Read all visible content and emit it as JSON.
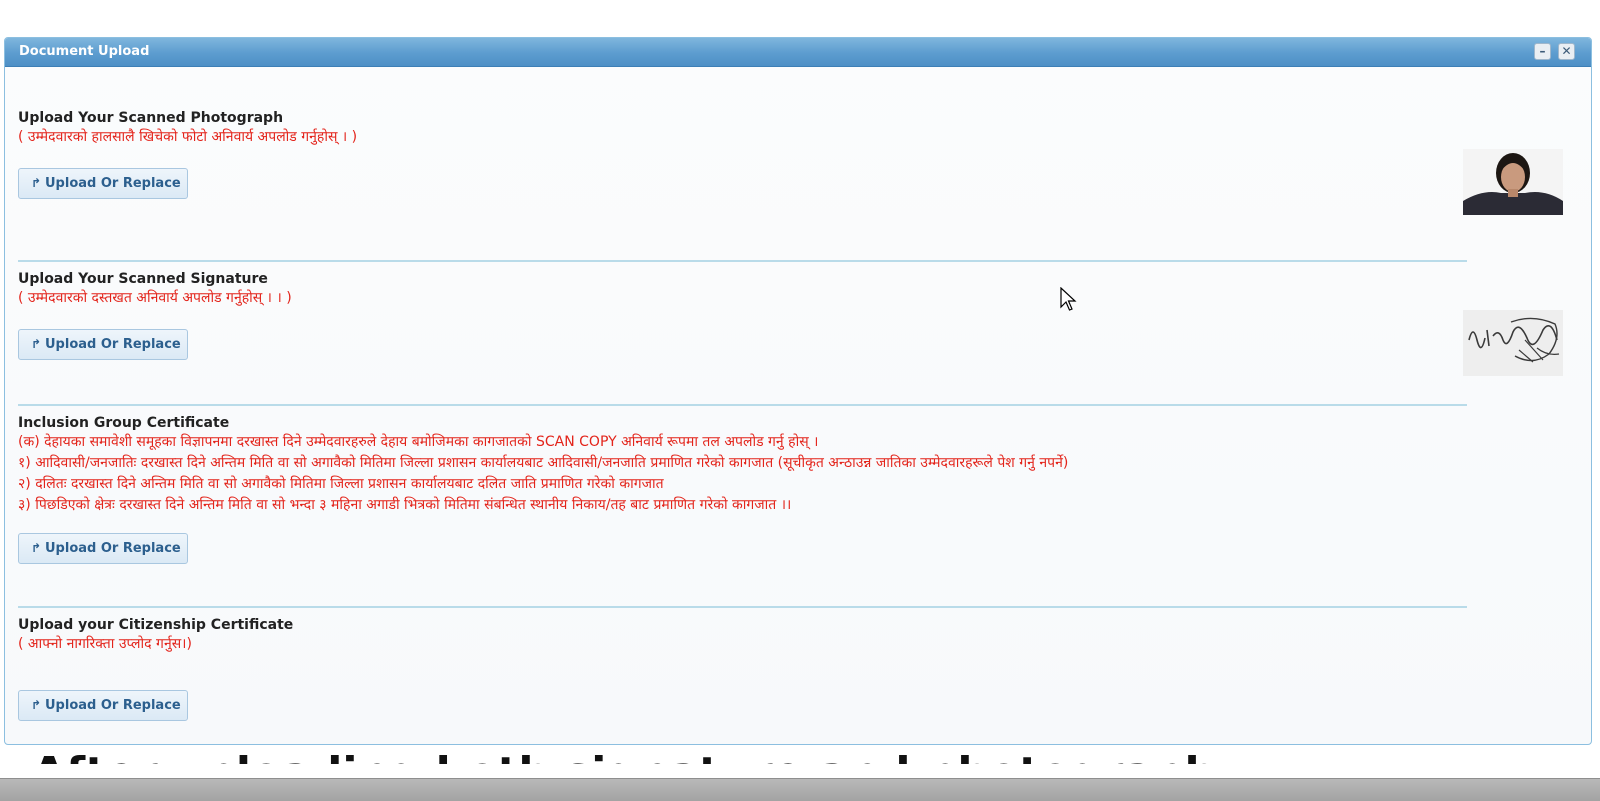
{
  "dialog": {
    "title": "Document Upload",
    "minimize_icon": "minimize-icon",
    "close_icon": "close-icon"
  },
  "sections": [
    {
      "title": "Upload Your Scanned Photograph",
      "notes": [
        "( उम्मेदवारको हालसालै खिचेको फोटो अनिवार्य अपलोड गर्नुहोस् । )"
      ],
      "button_label": "Upload Or Replace",
      "thumbnail": "applicant-photo"
    },
    {
      "title": "Upload Your Scanned Signature",
      "notes": [
        "( उम्मेदवारको दस्तखत अनिवार्य अपलोड गर्नुहोस् । । )"
      ],
      "button_label": "Upload Or Replace",
      "thumbnail": "applicant-signature"
    },
    {
      "title": "Inclusion Group Certificate",
      "notes": [
        "(क) देहायका समावेशी समूहका विज्ञापनमा दरखास्त दिने उम्मेदवारहरुले देहाय बमोजिमका कागजातको SCAN COPY अनिवार्य रूपमा तल अपलोड गर्नु होस् ।",
        "१) आदिवासी/जनजातिः दरखास्त दिने अन्तिम मिति वा सो अगावैको मितिमा जिल्ला प्रशासन कार्यालयबाट आदिवासी/जनजाति प्रमाणित गरेको कागजात (सूचीकृत अन्ठाउन्न जातिका उम्मेदवारहरूले पेश गर्नु नपर्ने)",
        "२) दलितः दरखास्त दिने अन्तिम मिति वा सो अगावैको मितिमा जिल्ला प्रशासन कार्यालयबाट दलित जाति प्रमाणित गरेको कागजात",
        "३) पिछडिएको क्षेत्रः दरखास्त दिने अन्तिम मिति वा सो भन्दा ३ महिना अगाडी भित्रको मितिमा संबन्धित स्थानीय निकाय/तह बाट प्रमाणित गरेको कागजात ।।"
      ],
      "button_label": "Upload Or Replace"
    },
    {
      "title": "Upload your Citizenship Certificate",
      "notes": [
        "( आफ्नो नागरिक्ता उप्लोद गर्नुस।)"
      ],
      "button_label": "Upload Or Replace"
    }
  ],
  "upload_icon": "upload-arrow-icon",
  "background_text": "After uploading both signature and photograph",
  "colors": {
    "titlebar": "#5c9ccf",
    "note_red": "#e3241b",
    "button_text": "#2c5f8e",
    "divider": "#b9dbe9"
  }
}
